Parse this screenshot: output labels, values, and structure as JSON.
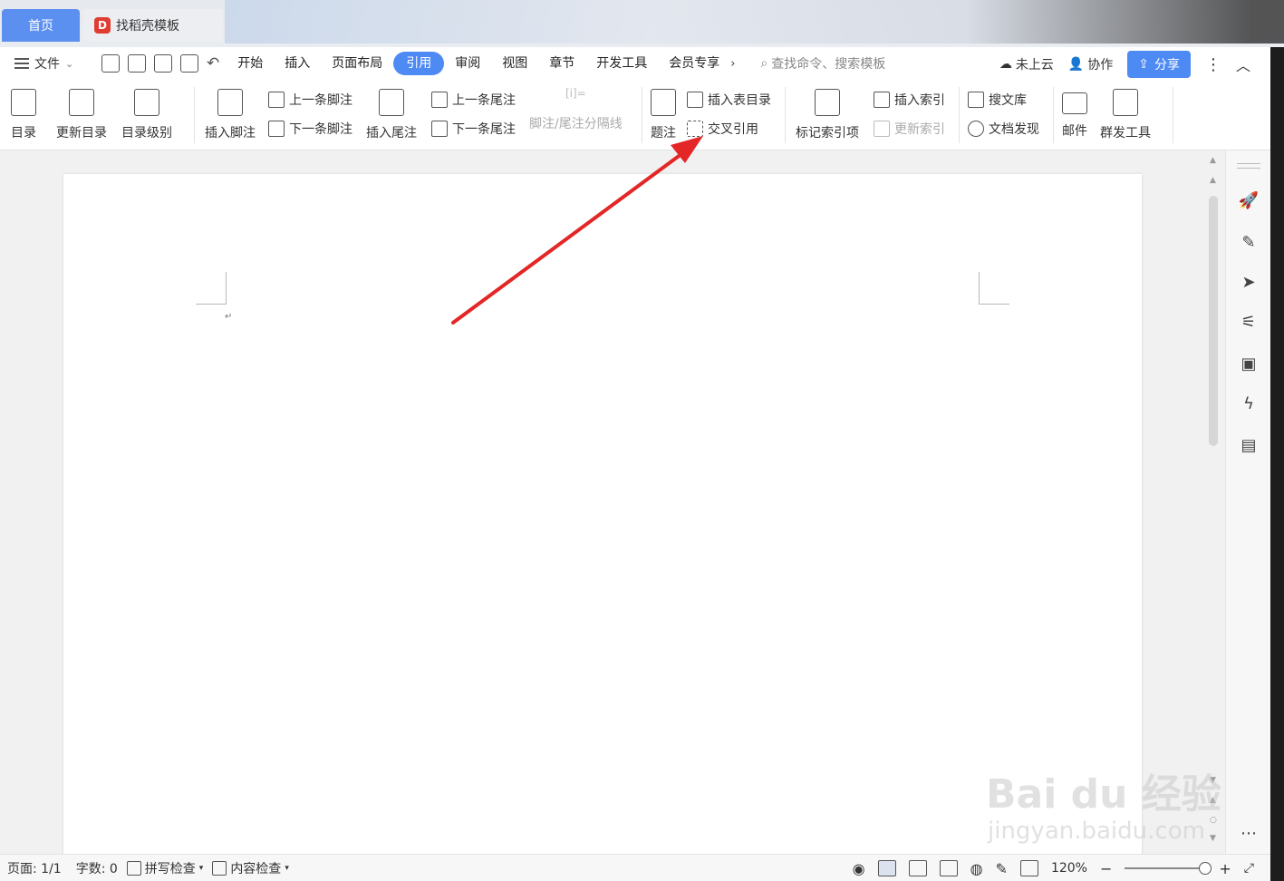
{
  "tabs": {
    "home": "首页",
    "doc": "找稻壳模板"
  },
  "menubar": {
    "file": "文件",
    "items": [
      "开始",
      "插入",
      "页面布局",
      "引用",
      "审阅",
      "视图",
      "章节",
      "开发工具",
      "会员专享"
    ],
    "active_index": 3,
    "search_placeholder": "查找命令、搜索模板",
    "cloud": "未上云",
    "collab": "协作",
    "share": "分享"
  },
  "ribbon": {
    "toc": "目录",
    "update_toc": "更新目录",
    "toc_level": "目录级别",
    "insert_footnote": "插入脚注",
    "prev_footnote": "上一条脚注",
    "next_footnote": "下一条脚注",
    "insert_endnote": "插入尾注",
    "prev_endnote": "上一条尾注",
    "next_endnote": "下一条尾注",
    "note_separator": "脚注/尾注分隔线",
    "caption": "题注",
    "insert_table_of_figures": "插入表目录",
    "cross_reference": "交叉引用",
    "mark_index_entry": "标记索引项",
    "insert_index": "插入索引",
    "update_index": "更新索引",
    "search_library": "搜文库",
    "doc_discover": "文档发现",
    "mail": "邮件",
    "mass_tool": "群发工具"
  },
  "status": {
    "page": "页面: 1/1",
    "words": "字数: 0",
    "spell": "拼写检查",
    "content_check": "内容检查",
    "zoom": "120%"
  },
  "watermark": {
    "main": "Bai du 经验",
    "sub": "jingyan.baidu.com"
  },
  "colors": {
    "accent": "#4e8af3",
    "arrow": "#e32626",
    "tab_home": "#5b8ff0"
  }
}
